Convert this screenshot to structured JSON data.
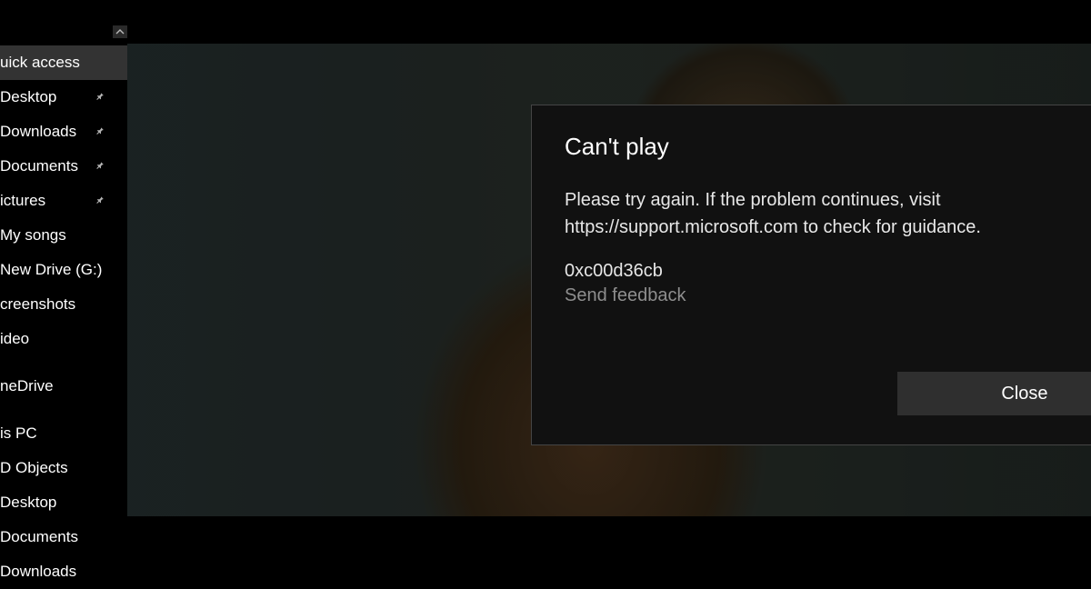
{
  "sidebar": {
    "items": [
      {
        "label": "uick access",
        "pinned": false,
        "selected": true
      },
      {
        "label": "Desktop",
        "pinned": true,
        "selected": false
      },
      {
        "label": "Downloads",
        "pinned": true,
        "selected": false
      },
      {
        "label": "Documents",
        "pinned": true,
        "selected": false
      },
      {
        "label": "ictures",
        "pinned": true,
        "selected": false
      },
      {
        "label": "My songs",
        "pinned": false,
        "selected": false
      },
      {
        "label": "New Drive (G:)",
        "pinned": false,
        "selected": false
      },
      {
        "label": "creenshots",
        "pinned": false,
        "selected": false
      },
      {
        "label": "ideo",
        "pinned": false,
        "selected": false
      },
      {
        "label": "neDrive",
        "pinned": false,
        "selected": false
      },
      {
        "label": "is PC",
        "pinned": false,
        "selected": false
      },
      {
        "label": "D Objects",
        "pinned": false,
        "selected": false
      },
      {
        "label": "Desktop",
        "pinned": false,
        "selected": false
      },
      {
        "label": "Documents",
        "pinned": false,
        "selected": false
      },
      {
        "label": "Downloads",
        "pinned": false,
        "selected": false
      }
    ]
  },
  "dialog": {
    "title": "Can't play",
    "message": "Please try again. If the problem continues, visit https://support.microsoft.com to check for guidance.",
    "error_code": "0xc00d36cb",
    "feedback_label": "Send feedback",
    "close_label": "Close"
  }
}
